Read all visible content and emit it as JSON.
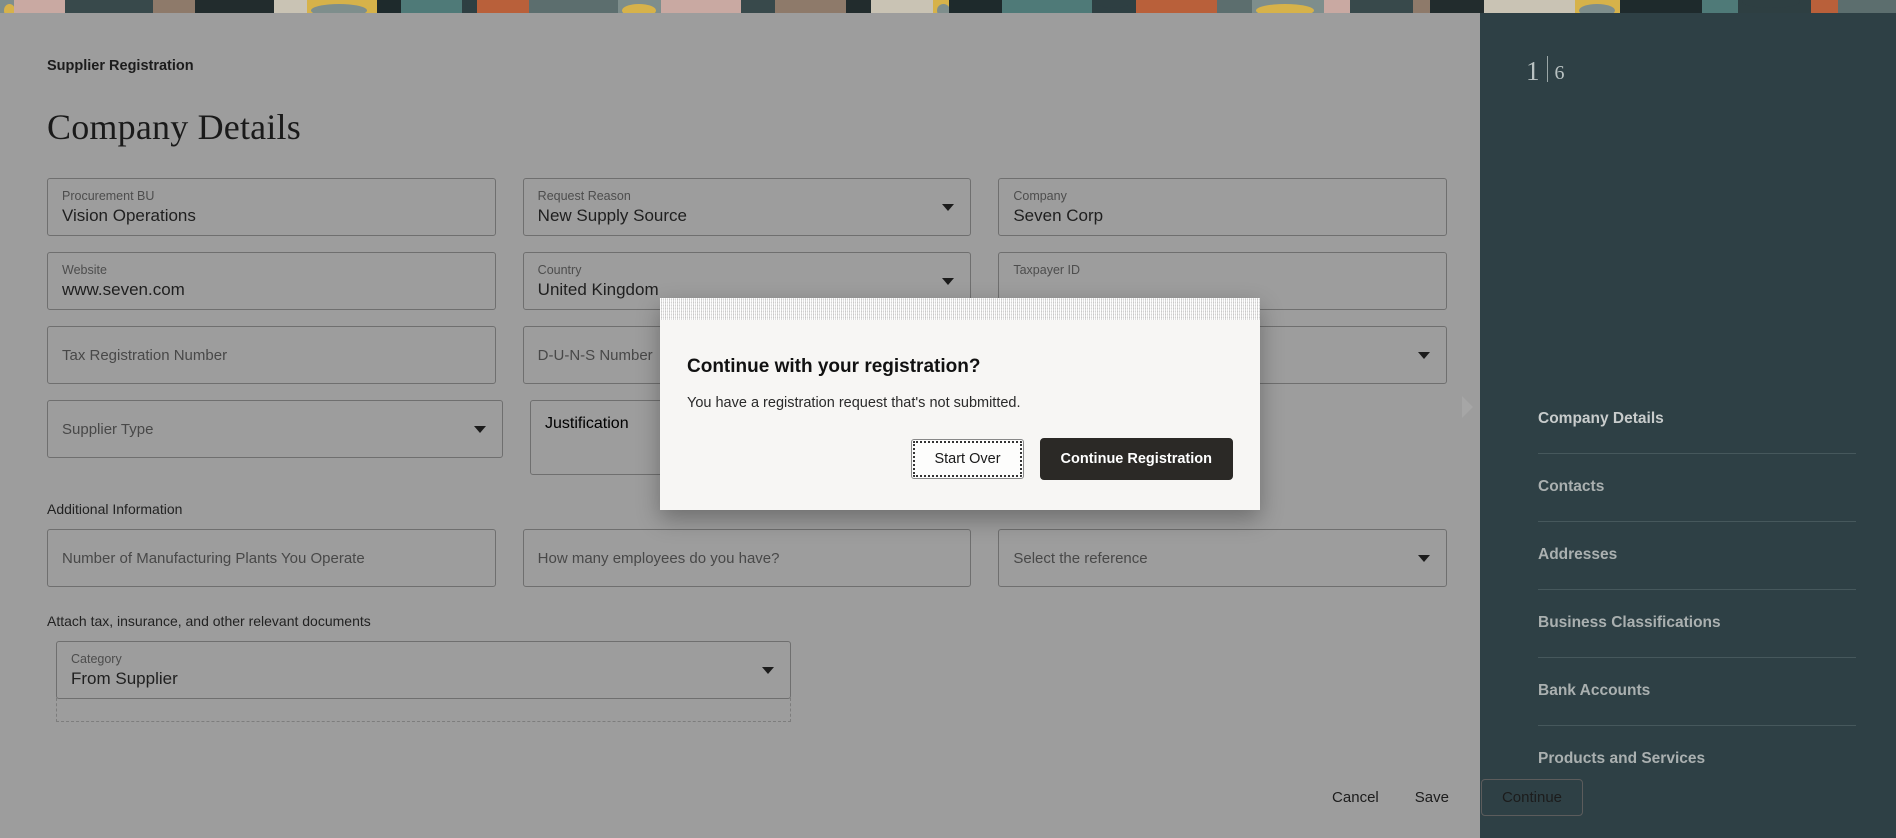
{
  "header": {
    "banner_alt": "decorative-abstract-pattern"
  },
  "breadcrumb": "Supplier Registration",
  "page_title": "Company Details",
  "form": {
    "rows": [
      [
        {
          "name": "procurement-bu",
          "label": "Procurement BU",
          "value": "Vision Operations",
          "type": "text"
        },
        {
          "name": "request-reason",
          "label": "Request Reason",
          "value": "New Supply Source",
          "type": "select"
        },
        {
          "name": "company",
          "label": "Company",
          "value": "Seven Corp",
          "type": "text"
        }
      ],
      [
        {
          "name": "website",
          "label": "Website",
          "value": "www.seven.com",
          "type": "text"
        },
        {
          "name": "country",
          "label": "Country",
          "value": "United Kingdom",
          "type": "select"
        },
        {
          "name": "taxpayer-id",
          "label": "Taxpayer ID",
          "value": "",
          "type": "text"
        }
      ],
      [
        {
          "name": "tax-registration-number",
          "placeholder": "Tax Registration Number",
          "type": "text"
        },
        {
          "name": "duns-number",
          "placeholder": "D-U-N-S Number",
          "type": "text"
        },
        {
          "name": "tax-country",
          "placeholder": "",
          "type": "select"
        }
      ],
      [
        {
          "name": "supplier-type",
          "placeholder": "Supplier Type",
          "type": "select"
        },
        {
          "name": "justification",
          "placeholder": "Justification",
          "type": "textarea"
        }
      ]
    ]
  },
  "additional_information": {
    "label": "Additional Information",
    "fields": [
      {
        "name": "manufacturing-plants",
        "placeholder": "Number of Manufacturing Plants You Operate",
        "type": "text"
      },
      {
        "name": "employee-count",
        "placeholder": "How many employees do you have?",
        "type": "text"
      },
      {
        "name": "reference",
        "placeholder": "Select the reference",
        "type": "select"
      }
    ]
  },
  "attachments": {
    "label": "Attach tax, insurance, and other relevant documents",
    "category": {
      "name": "category",
      "label": "Category",
      "value": "From Supplier"
    }
  },
  "footer": {
    "cancel": "Cancel",
    "save": "Save",
    "continue": "Continue"
  },
  "rail": {
    "current_step": "1",
    "separator": "|",
    "total_steps": "6",
    "accent_bg": "#2e4045",
    "items": [
      {
        "label": "Company Details",
        "active": true
      },
      {
        "label": "Contacts",
        "active": false
      },
      {
        "label": "Addresses",
        "active": false
      },
      {
        "label": "Business Classifications",
        "active": false
      },
      {
        "label": "Bank Accounts",
        "active": false
      },
      {
        "label": "Products and Services",
        "active": false
      }
    ]
  },
  "dialog": {
    "title": "Continue with your registration?",
    "message": "You have a registration request that's not submitted.",
    "secondary_label": "Start Over",
    "primary_label": "Continue Registration",
    "primary_color": "#2b2926"
  }
}
